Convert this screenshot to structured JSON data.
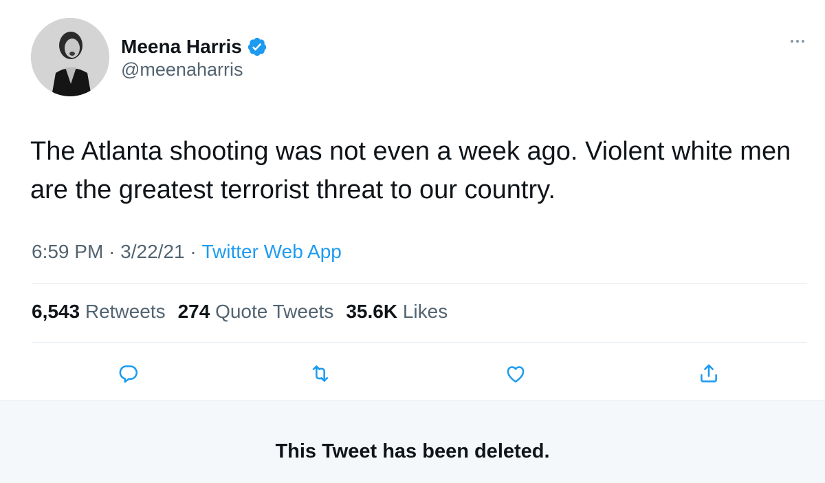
{
  "author": {
    "display_name": "Meena Harris",
    "handle": "@meenaharris",
    "verified": true,
    "avatar_icon": "profile-photo"
  },
  "tweet": {
    "text": "The Atlanta shooting was not even a week ago. Violent white men are the greatest terrorist threat to our country.",
    "time": "6:59 PM",
    "separator": " · ",
    "date": "3/22/21",
    "source": "Twitter Web App"
  },
  "stats": [
    {
      "count": "6,543",
      "label": "Retweets"
    },
    {
      "count": "274",
      "label": "Quote Tweets"
    },
    {
      "count": "35.6K",
      "label": "Likes"
    }
  ],
  "actions": [
    "reply-icon",
    "retweet-icon",
    "like-icon",
    "share-icon"
  ],
  "notice": {
    "text": "This Tweet has been deleted."
  },
  "colors": {
    "accent": "#1d9bf0",
    "text_primary": "#0f1419",
    "text_secondary": "#536471",
    "icon": "#1d9bf0",
    "banner_bg": "#f5f8fa"
  }
}
